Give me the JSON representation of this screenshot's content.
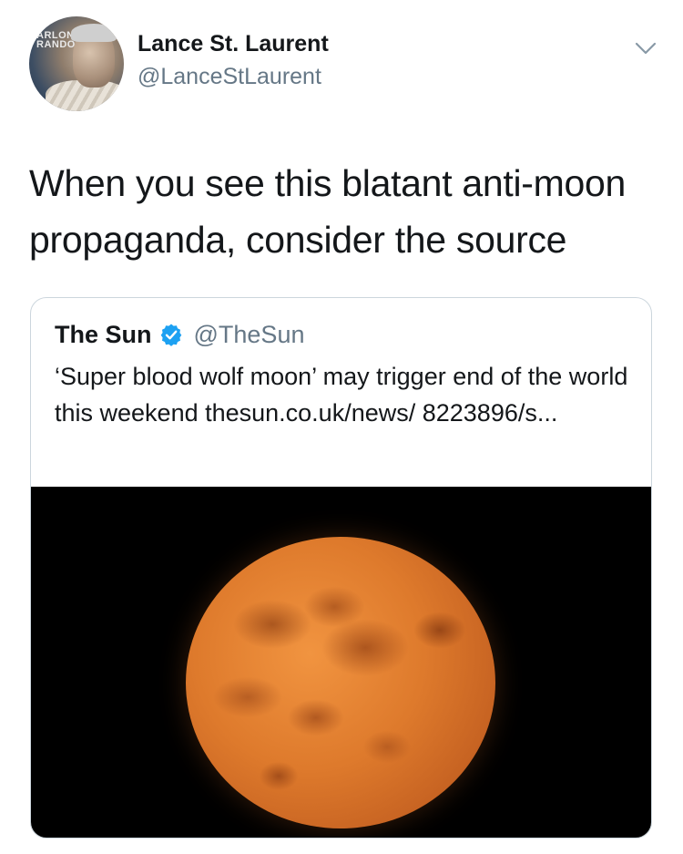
{
  "author": {
    "name": "Lance St. Laurent",
    "handle": "@LanceStLaurent",
    "avatar_text": "ARLON\nRANDO"
  },
  "tweet": {
    "text": "When you see this blatant anti-moon propaganda, consider the source"
  },
  "quoted": {
    "name": "The Sun",
    "handle": "@TheSun",
    "verified": true,
    "text": "‘Super blood wolf moon’ may trigger end of the world this weekend thesun.co.uk/news/ 8223896/s...",
    "image": "red-orange full moon on black background"
  },
  "icons": {
    "menu": "chevron-down-icon",
    "verified": "verified-badge-icon"
  },
  "colors": {
    "text_primary": "#14171a",
    "text_secondary": "#657786",
    "border": "#ccd6dd",
    "verified_blue": "#1da1f2",
    "moon_orange": "#de7a2c"
  }
}
